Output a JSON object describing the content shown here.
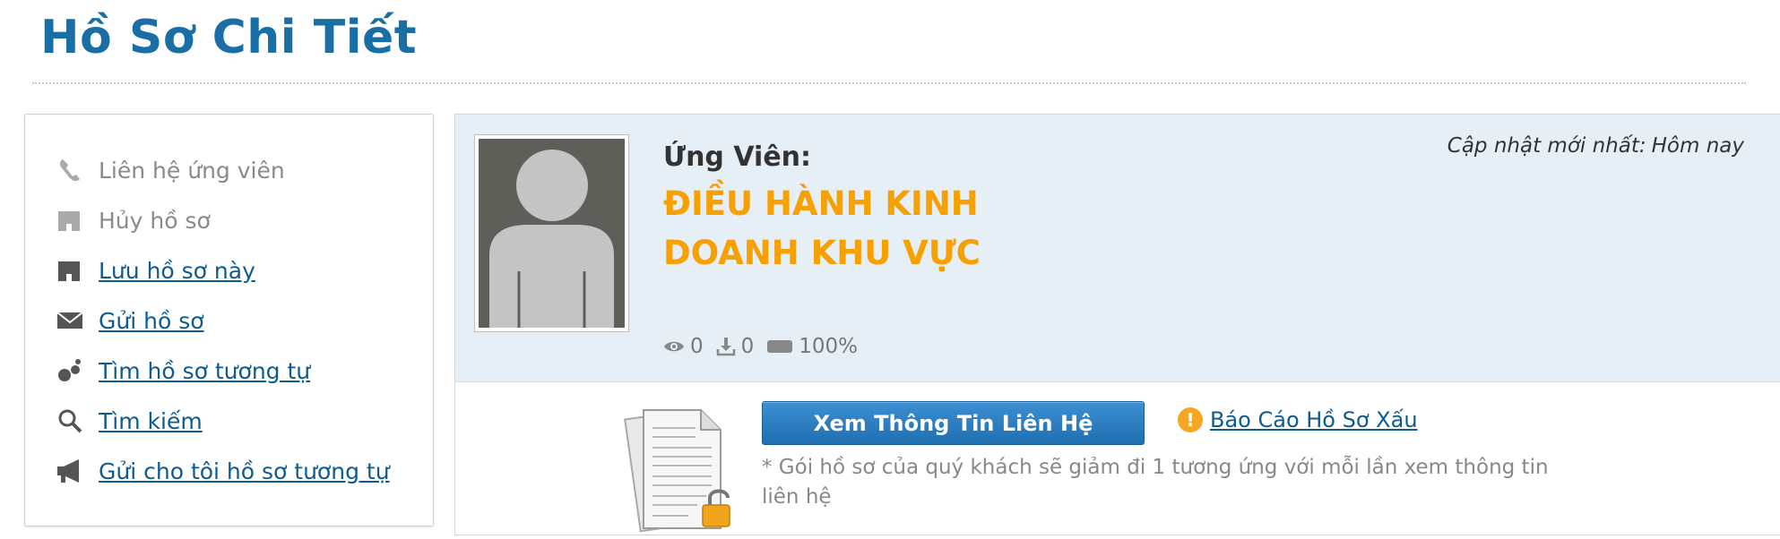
{
  "page": {
    "title": "Hồ Sơ Chi Tiết"
  },
  "sidebar": {
    "items": [
      {
        "label": "Liên hệ ứng viên",
        "icon": "phone-icon",
        "enabled": false
      },
      {
        "label": "Hủy hồ sơ",
        "icon": "folder-icon",
        "enabled": false
      },
      {
        "label": "Lưu hồ sơ này",
        "icon": "folder-icon",
        "enabled": true
      },
      {
        "label": "Gửi hồ sơ",
        "icon": "envelope-icon",
        "enabled": true
      },
      {
        "label": "Tìm hồ sơ tương tự",
        "icon": "people-icon",
        "enabled": true
      },
      {
        "label": "Tìm kiếm",
        "icon": "magnifier-icon",
        "enabled": true
      },
      {
        "label": "Gửi cho tôi hồ sơ tương tự",
        "icon": "megaphone-icon",
        "enabled": true
      }
    ]
  },
  "candidate": {
    "label": "Ứng Viên:",
    "title_line1": "ĐIỀU HÀNH KINH",
    "title_line2": "DOANH KHU VỰC",
    "updated_label": "Cập nhật mới nhất:",
    "updated_value": "Hôm nay",
    "stats": {
      "views": "0",
      "downloads": "0",
      "completeness": "100%"
    }
  },
  "actions": {
    "view_contact_label": "Xem Thông Tin Liên Hệ",
    "report_label": "Báo Cáo Hồ Sơ Xấu",
    "note": "* Gói hồ sơ của quý khách sẽ giảm đi 1 tương ứng với mỗi lần xem thông tin liên hệ"
  },
  "colors": {
    "title_blue": "#1a6ea6",
    "job_orange": "#f7a000",
    "link_blue": "#0d5b8f",
    "panel_bg": "#e5eff5",
    "button_blue": "#2a7dc2",
    "warn_orange": "#f5a623"
  }
}
